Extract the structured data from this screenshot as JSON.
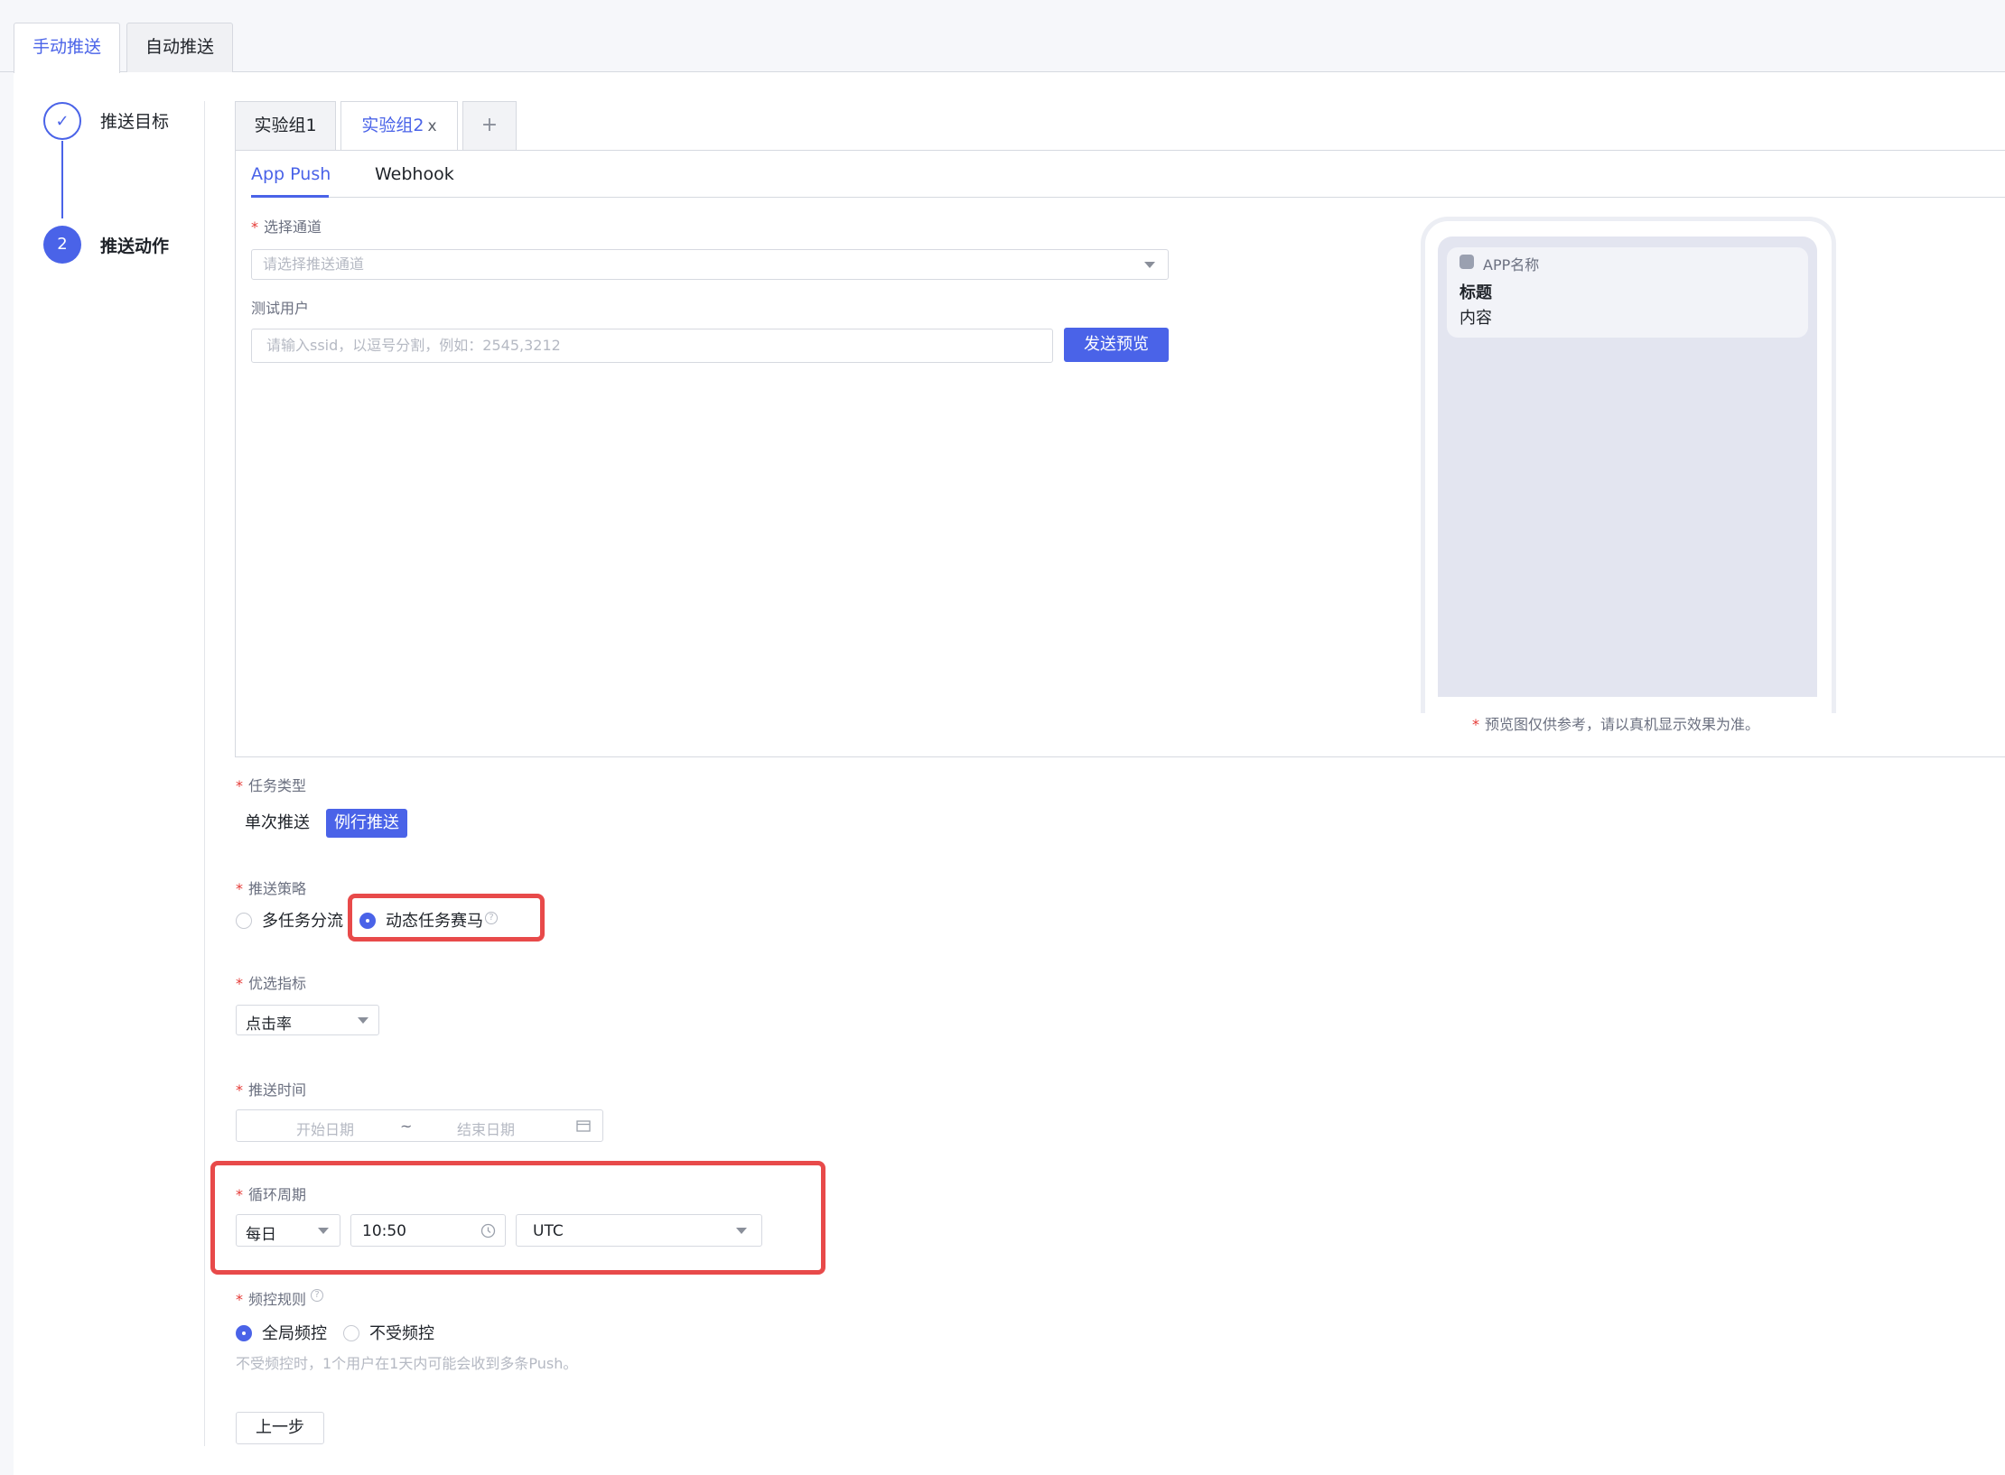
{
  "top_tabs": {
    "manual": "手动推送",
    "auto": "自动推送"
  },
  "steps": {
    "target": "推送目标",
    "action": "推送动作",
    "action_index": "2",
    "done_mark": "✓"
  },
  "groups": {
    "g1": "实验组1",
    "g2": "实验组2",
    "close": "x",
    "add": "+"
  },
  "sub_tabs": {
    "app_push": "App Push",
    "webhook": "Webhook"
  },
  "channel": {
    "label": "选择通道",
    "placeholder": "请选择推送通道"
  },
  "test_user": {
    "label": "测试用户",
    "placeholder": "请输入ssid，以逗号分割，例如：2545,3212",
    "send_preview": "发送预览"
  },
  "preview": {
    "app_name": "APP名称",
    "title": "标题",
    "content": "内容",
    "note": "预览图仅供参考，请以真机显示效果为准。"
  },
  "task_type": {
    "label": "任务类型",
    "single": "单次推送",
    "routine": "例行推送"
  },
  "strategy": {
    "label": "推送策略",
    "multi": "多任务分流",
    "dynamic": "动态任务赛马",
    "help": "?"
  },
  "metric": {
    "label": "优选指标",
    "value": "点击率"
  },
  "push_time": {
    "label": "推送时间",
    "start": "开始日期",
    "sep": "~",
    "end": "结束日期"
  },
  "cycle": {
    "label": "循环周期",
    "period": "每日",
    "time": "10:50",
    "timezone": "UTC"
  },
  "freq": {
    "label": "频控规则",
    "global": "全局频控",
    "none": "不受频控",
    "hint": "不受频控时，1个用户在1天内可能会收到多条Push。",
    "help": "?"
  },
  "footer": {
    "prev": "上一步"
  },
  "required_mark": "*",
  "colors": {
    "accent": "#4a63e8",
    "highlight": "#e84a4a"
  }
}
